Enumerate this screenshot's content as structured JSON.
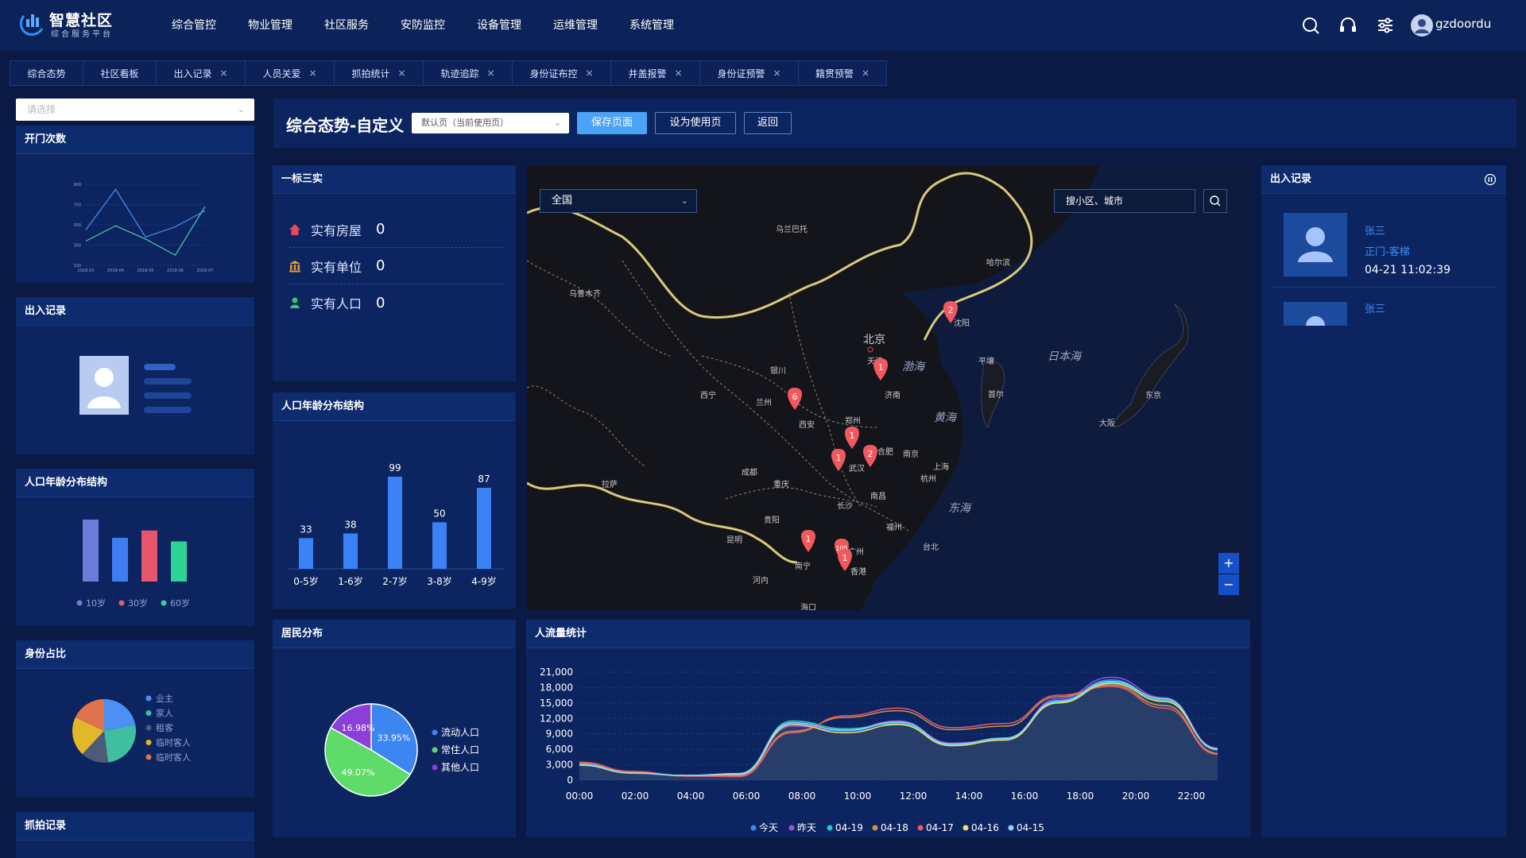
{
  "header": {
    "logo_title": "智慧社区",
    "logo_subtitle": "综合服务平台",
    "nav": [
      "综合管控",
      "物业管理",
      "社区服务",
      "安防监控",
      "设备管理",
      "运维管理",
      "系统管理"
    ],
    "username": "gzdoordu"
  },
  "tabs": [
    {
      "label": "综合态势",
      "closable": false
    },
    {
      "label": "社区看板",
      "closable": false
    },
    {
      "label": "出入记录",
      "closable": true
    },
    {
      "label": "人员关爱",
      "closable": true
    },
    {
      "label": "抓拍统计",
      "closable": true
    },
    {
      "label": "轨迹追踪",
      "closable": true
    },
    {
      "label": "身份证布控",
      "closable": true
    },
    {
      "label": "井盖报警",
      "closable": true
    },
    {
      "label": "身份证预警",
      "closable": true
    },
    {
      "label": "籍贯预警",
      "closable": true
    }
  ],
  "close_glyph": "×",
  "left": {
    "select_placeholder": "请选择",
    "door_title": "开门次数",
    "record_title": "出入记录",
    "age_title": "人口年龄分布结构",
    "identity_title": "身份占比",
    "capture_title": "抓拍记录"
  },
  "toolbar": {
    "title": "综合态势-自定义",
    "select_value": "默认页（当前使用页）",
    "save_label": "保存页面",
    "set_label": "设为使用页",
    "back_label": "返回"
  },
  "one_standard": {
    "title": "一标三实",
    "rows": [
      {
        "label": "实有房屋",
        "value": "0",
        "color": "#e8485a"
      },
      {
        "label": "实有单位",
        "value": "0",
        "color": "#e89a2a"
      },
      {
        "label": "实有人口",
        "value": "0",
        "color": "#3ec46d"
      }
    ]
  },
  "map": {
    "region_select": "全国",
    "search_placeholder": "搜小区、城市",
    "zoom_in": "+",
    "zoom_out": "−",
    "labels": {
      "beijing": "北京",
      "bohai": "渤海",
      "huanghai": "黄海",
      "donghai": "东海",
      "japan_sea": "日本海",
      "hohhot": "乌兰巴托",
      "urumqi": "乌鲁木齐",
      "harbin": "哈尔滨",
      "shenyang": "沈阳",
      "tianjin": "天津",
      "jinan": "济南",
      "shanghai": "上海",
      "hangzhou": "杭州",
      "nanjing": "南京",
      "hefei": "合肥",
      "wuhan": "武汉",
      "changsha": "长沙",
      "nanchang": "南昌",
      "fuzhou": "福州",
      "taipei": "台北",
      "guangzhou": "广州",
      "hongkong": "香港",
      "haikou": "海口",
      "nanning": "南宁",
      "kunming": "昆明",
      "guiyang": "贵阳",
      "chongqing": "重庆",
      "chengdu": "成都",
      "xian": "西安",
      "lanzhou": "兰州",
      "xining": "西宁",
      "yinchuan": "银川",
      "zhengzhou": "郑州",
      "lhasa": "拉萨",
      "seoul": "首尔",
      "pyongyang": "平壤",
      "hanoi": "河内",
      "tokyo": "东京",
      "osaka": "大阪"
    },
    "markers": [
      {
        "label": "2"
      },
      {
        "label": "1"
      },
      {
        "label": "6"
      },
      {
        "label": "1"
      },
      {
        "label": "1"
      },
      {
        "label": "2"
      },
      {
        "label": "105"
      },
      {
        "label": "1"
      },
      {
        "label": "1"
      }
    ]
  },
  "access_right": {
    "title": "出入记录",
    "records": [
      {
        "name": "张三",
        "location": "正门-客梯",
        "time": "04-21 11:02:39"
      },
      {
        "name": "张三"
      }
    ]
  },
  "residents": {
    "title": "居民分布",
    "slices": [
      {
        "name": "流动人口",
        "value": 33.95,
        "label": "33.95%",
        "color": "#3b86f0"
      },
      {
        "name": "常住人口",
        "value": 49.07,
        "label": "49.07%",
        "color": "#5fdb6a"
      },
      {
        "name": "其他人口",
        "value": 16.98,
        "label": "16.98%",
        "color": "#8a3fd8"
      }
    ]
  },
  "flow": {
    "title": "人流量统计"
  },
  "chart_data": [
    {
      "id": "door_chart",
      "type": "line",
      "title": "开门次数",
      "x": [
        "2018-03",
        "2018-04",
        "2018-05",
        "2018-06",
        "2018-07"
      ],
      "y_ticks": [
        "100",
        "300",
        "500",
        "700",
        "900"
      ],
      "ylim": [
        100,
        900
      ],
      "series": [
        {
          "values": [
            450,
            850,
            380,
            480,
            640
          ],
          "color": "#4a8ef2"
        },
        {
          "values": [
            340,
            490,
            360,
            200,
            680
          ],
          "color": "#53c7a4"
        }
      ]
    },
    {
      "id": "left_age_chart",
      "type": "bar",
      "title": "人口年龄分布结构",
      "series": [
        {
          "name": "10岁",
          "values": [
            85
          ],
          "color": "#6b7bd6"
        },
        {
          "name": "30岁",
          "values": [
            60
          ],
          "color": "#e9566a"
        },
        {
          "name": "60岁",
          "values": [
            55
          ],
          "color": "#2ed39a"
        }
      ],
      "bars": [
        {
          "value": 85,
          "color": "#6b7bd6"
        },
        {
          "value": 60,
          "color": "#3f7ef0"
        },
        {
          "value": 70,
          "color": "#e9566a"
        },
        {
          "value": 55,
          "color": "#2ed39a"
        }
      ]
    },
    {
      "id": "identity_pie",
      "type": "pie",
      "title": "身份占比",
      "slices": [
        {
          "name": "业主",
          "value": 22,
          "color": "#4d8ff5"
        },
        {
          "name": "家人",
          "value": 26,
          "color": "#3fbfa0"
        },
        {
          "name": "租客",
          "value": 14,
          "color": "#4e5b78"
        },
        {
          "name": "临时客人",
          "value": 20,
          "color": "#e3b72a"
        },
        {
          "name": "临时客人",
          "value": 18,
          "color": "#e0734b"
        }
      ]
    },
    {
      "id": "age_bar",
      "type": "bar",
      "title": "人口年龄分布结构",
      "categories": [
        "0-5岁",
        "1-6岁",
        "2-7岁",
        "3-8岁",
        "4-9岁"
      ],
      "values": [
        33,
        38,
        99,
        50,
        87
      ],
      "ylim": [
        0,
        99
      ]
    },
    {
      "id": "resident_pie",
      "type": "pie",
      "title": "居民分布",
      "categories": [
        "流动人口",
        "常住人口",
        "其他人口"
      ],
      "values": [
        33.95,
        49.07,
        16.98
      ]
    },
    {
      "id": "flow_chart",
      "type": "line",
      "title": "人流量统计",
      "x": [
        "00:00",
        "02:00",
        "04:00",
        "06:00",
        "08:00",
        "10:00",
        "12:00",
        "14:00",
        "16:00",
        "18:00",
        "20:00",
        "22:00"
      ],
      "y_ticks": [
        "0",
        "3,000",
        "6,000",
        "9,000",
        "12,000",
        "15,000",
        "18,000",
        "21,000"
      ],
      "ylim": [
        0,
        21000
      ],
      "series": [
        {
          "name": "今天",
          "color": "#2f8ff2",
          "values": [
            3000,
            1400,
            900,
            1200,
            11000,
            9500,
            11200,
            7000,
            8000,
            15500,
            19500,
            15500,
            6000
          ]
        },
        {
          "name": "昨天",
          "color": "#9a55e0",
          "values": [
            3200,
            1500,
            850,
            1000,
            10500,
            9800,
            11500,
            7200,
            7800,
            15800,
            20000,
            16000,
            6200
          ]
        },
        {
          "name": "04-19",
          "color": "#20c9c7",
          "values": [
            3100,
            1450,
            900,
            1300,
            11500,
            10000,
            11000,
            6800,
            8200,
            15200,
            19000,
            15600,
            5900
          ]
        },
        {
          "name": "04-18",
          "color": "#d4904a",
          "values": [
            3400,
            1600,
            800,
            800,
            9500,
            12200,
            13500,
            9800,
            10500,
            16200,
            18500,
            14500,
            5200
          ]
        },
        {
          "name": "04-17",
          "color": "#e85a6a",
          "values": [
            3500,
            1700,
            800,
            700,
            9200,
            12500,
            14000,
            10200,
            11000,
            16500,
            18200,
            14000,
            5000
          ]
        },
        {
          "name": "04-16",
          "color": "#f0e070",
          "values": [
            3000,
            1400,
            900,
            1100,
            10800,
            9200,
            10800,
            6700,
            7800,
            15000,
            18800,
            15300,
            6100
          ]
        },
        {
          "name": "04-15",
          "color": "#8fd3f5",
          "values": [
            2900,
            1350,
            900,
            1250,
            11200,
            9700,
            11300,
            7000,
            8100,
            15300,
            19200,
            15800,
            6000
          ]
        }
      ]
    }
  ]
}
